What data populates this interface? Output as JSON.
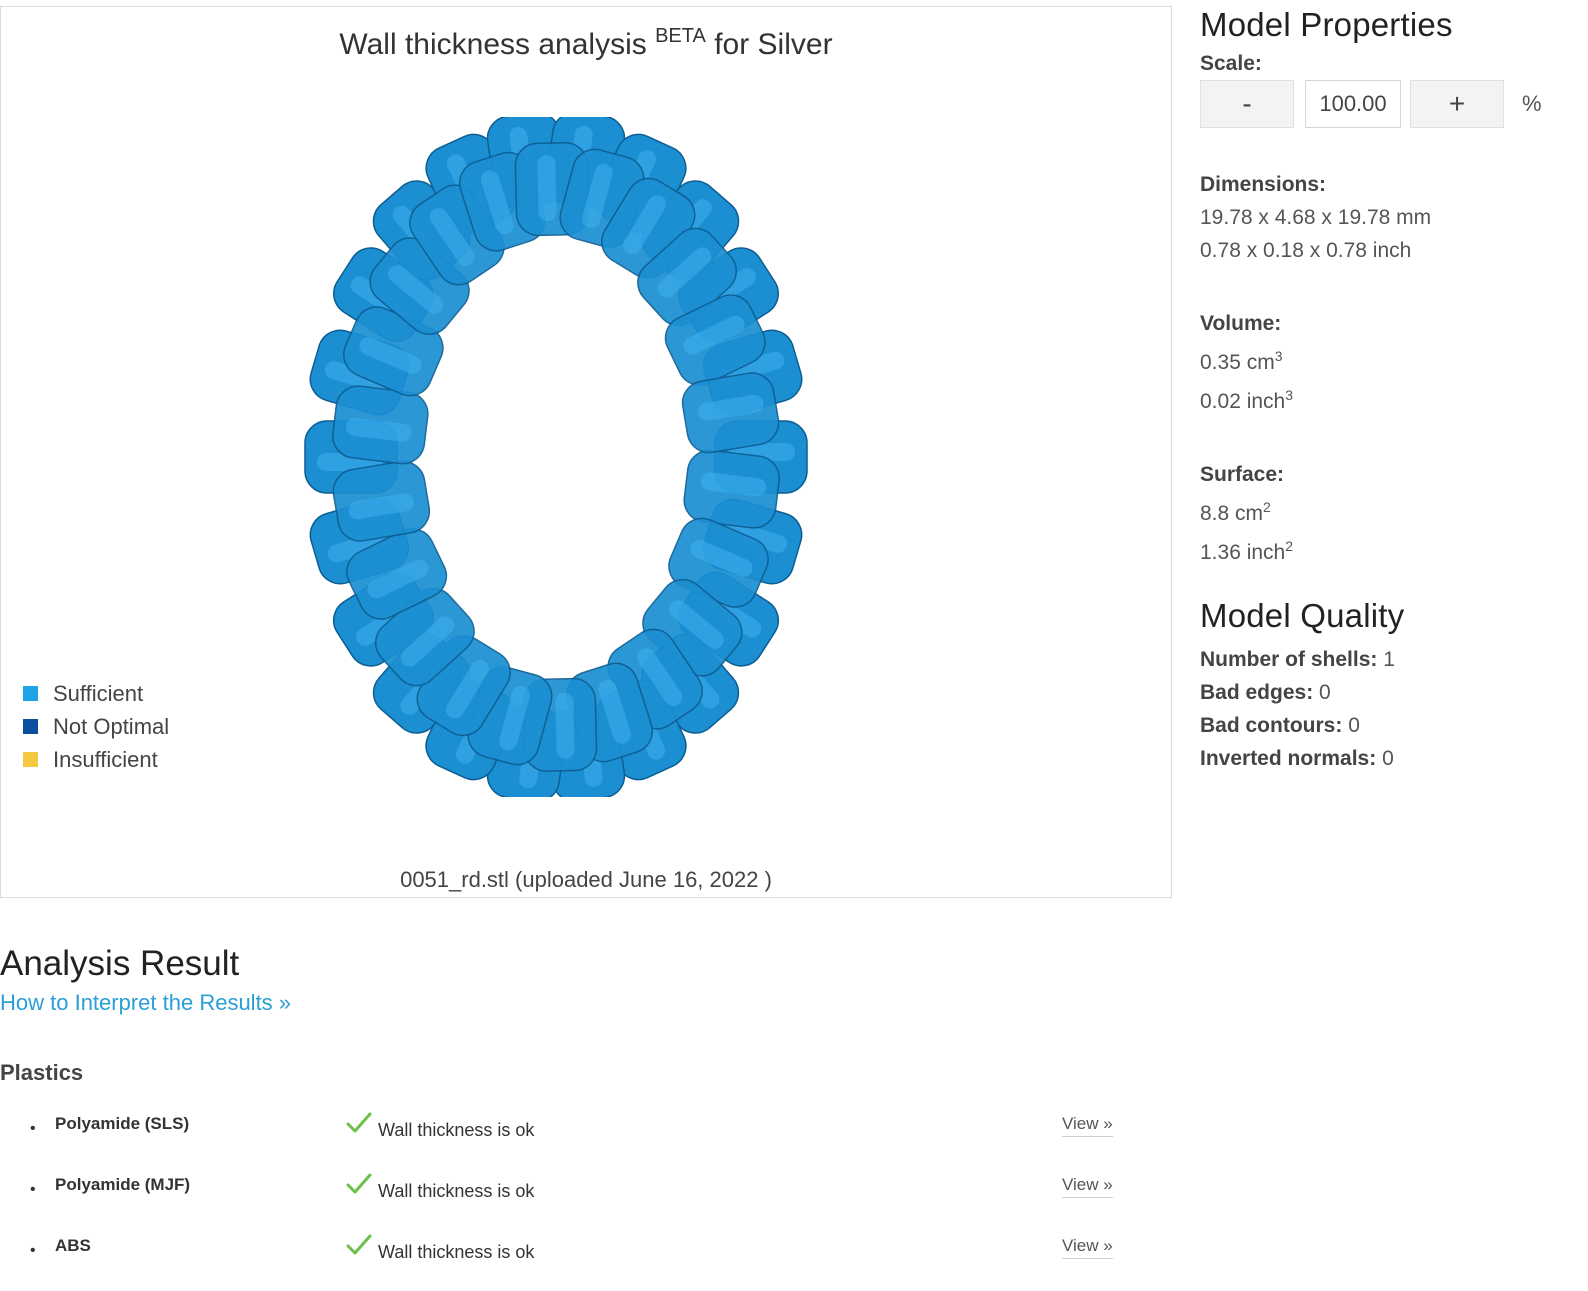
{
  "viewer": {
    "title_main": "Wall thickness analysis",
    "title_badge": "BETA",
    "title_suffix": "for Silver",
    "legend": [
      {
        "label": "Sufficient",
        "color": "#1ea3e6"
      },
      {
        "label": "Not Optimal",
        "color": "#0b4f9e"
      },
      {
        "label": "Insufficient",
        "color": "#f5c842"
      }
    ],
    "model_color": "#1b8fd2",
    "file_caption": "0051_rd.stl (uploaded June 16, 2022 )"
  },
  "properties": {
    "heading": "Model Properties",
    "scale": {
      "label": "Scale:",
      "minus": "-",
      "value": "100.00",
      "plus": "+",
      "unit": "%"
    },
    "dimensions": {
      "label": "Dimensions:",
      "mm": "19.78 x 4.68 x 19.78 mm",
      "inch": "0.78 x 0.18 x 0.78 inch"
    },
    "volume": {
      "label": "Volume:",
      "cm_value": "0.35 cm",
      "cm_exp": "3",
      "inch_value": "0.02 inch",
      "inch_exp": "3"
    },
    "surface": {
      "label": "Surface:",
      "cm_value": "8.8 cm",
      "cm_exp": "2",
      "inch_value": "1.36 inch",
      "inch_exp": "2"
    }
  },
  "quality": {
    "heading": "Model Quality",
    "rows": [
      {
        "label": "Number of shells:",
        "value": "1"
      },
      {
        "label": "Bad edges:",
        "value": "0"
      },
      {
        "label": "Bad contours:",
        "value": "0"
      },
      {
        "label": "Inverted normals:",
        "value": "0"
      }
    ]
  },
  "analysis": {
    "heading": "Analysis Result",
    "interpret_link": "How to Interpret the Results »",
    "group": "Plastics",
    "check_color": "#6cc04a",
    "results": [
      {
        "material": "Polyamide (SLS)",
        "status": "Wall thickness is ok",
        "link": "View »"
      },
      {
        "material": "Polyamide (MJF)",
        "status": "Wall thickness is ok",
        "link": "View »"
      },
      {
        "material": "ABS",
        "status": "Wall thickness is ok",
        "link": "View »"
      }
    ]
  }
}
